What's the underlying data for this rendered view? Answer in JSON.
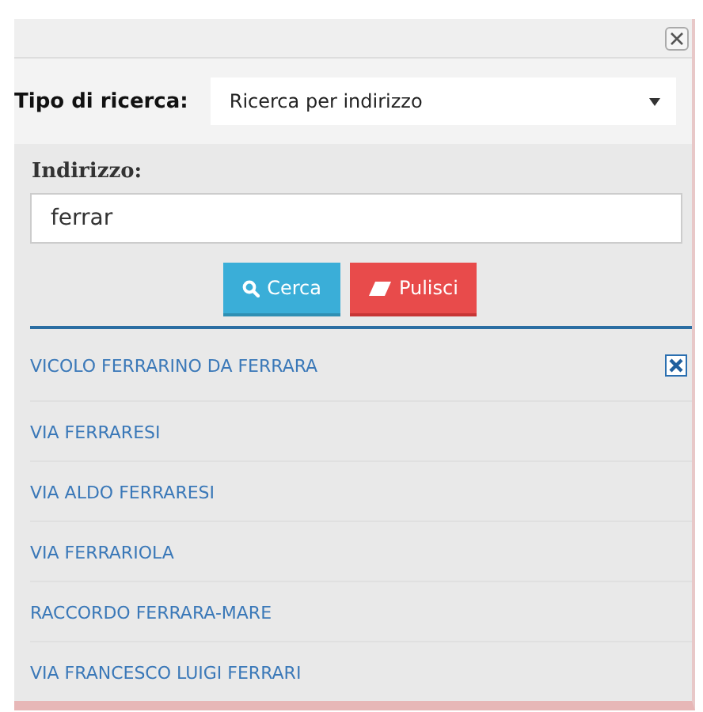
{
  "search_type": {
    "label": "Tipo di ricerca:",
    "value": "Ricerca per indirizzo"
  },
  "address": {
    "label": "Indirizzo:",
    "value": "ferrar"
  },
  "buttons": [
    {
      "kind": "search",
      "label": "Cerca"
    },
    {
      "kind": "clear",
      "label": "Pulisci"
    }
  ],
  "results": [
    "VICOLO FERRARINO DA FERRARA",
    "VIA FERRARESI",
    "VIA ALDO FERRARESI",
    "VIA FERRARIOLA",
    "RACCORDO FERRARA-MARE",
    "VIA FRANCESCO LUIGI FERRARI"
  ]
}
